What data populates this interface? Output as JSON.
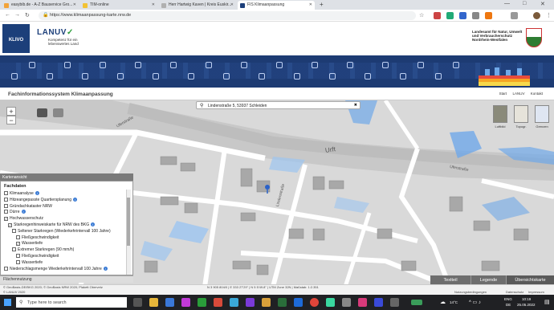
{
  "browser": {
    "tabs": [
      {
        "label": "easybib.de - A-Z Bauservice Gro...",
        "color": "#f2a33a"
      },
      {
        "label": "TIM-online",
        "color": "#f2c233"
      },
      {
        "label": "Herr Hartwig Kaven | Kreis Euskir...",
        "color": "#b0b0b0"
      },
      {
        "label": "FIS Klimaanpassung",
        "color": "#1c3f7a",
        "active": true
      }
    ],
    "new_tab": "+",
    "url": "https://www.klimaanpassung-karte.nrw.de"
  },
  "header": {
    "klivo": "KLIVO",
    "lanuv": "LANUV",
    "lanuv_tagline": "Kompetenz für ein lebenswertes Land",
    "agency": "Landesamt für Natur, Umwelt und Verbraucherschutz Nordrhein-Westfalen"
  },
  "titlebar": {
    "title": "Fachinformationssystem Klimaanpassung",
    "links": [
      "Start",
      "LANUV",
      "Kontakt"
    ]
  },
  "map": {
    "search_value": "Lindenstraße 5, 53937 Schleiden",
    "zoom_in": "+",
    "zoom_out": "−",
    "river_label": "Urft",
    "street_labels": [
      "Uferstraße",
      "Lindenstraße",
      "Uferstraße"
    ],
    "basemaps": [
      "Luftbild",
      "Topogr.",
      "Grenzen"
    ]
  },
  "panel": {
    "header": "Kartenansicht",
    "title": "Fachdaten",
    "layers": [
      {
        "label": "Klimaanalyse",
        "checked": false,
        "info": true,
        "indent": 0
      },
      {
        "label": "Hitzeangepasste Quartiersplanung",
        "checked": false,
        "info": true,
        "indent": 0
      },
      {
        "label": "Gründachkataster NRW",
        "checked": false,
        "info": false,
        "indent": 0
      },
      {
        "label": "Dürre",
        "checked": false,
        "info": true,
        "indent": 0
      },
      {
        "label": "Hochwasserschutz",
        "checked": true,
        "info": false,
        "indent": 0
      },
      {
        "label": "Starkregenhinweiskarte für NRW des BKG",
        "checked": true,
        "info": true,
        "indent": 1
      },
      {
        "label": "Seltener Starkregen (Wiederkehrintervall 100 Jahre)",
        "checked": false,
        "info": false,
        "indent": 2
      },
      {
        "label": "Fließgeschwindigkeit",
        "checked": false,
        "info": false,
        "indent": 3
      },
      {
        "label": "Wassertiefe",
        "checked": true,
        "info": false,
        "indent": 3
      },
      {
        "label": "Extremer Starkregen (90 mm/h)",
        "checked": false,
        "info": false,
        "indent": 2
      },
      {
        "label": "Fließgeschwindigkeit",
        "checked": false,
        "info": false,
        "indent": 3
      },
      {
        "label": "Wassertiefe",
        "checked": false,
        "info": false,
        "indent": 3
      },
      {
        "label": "Niederschlagsmenge Wiederkehrintervall 100 Jahre",
        "checked": false,
        "info": true,
        "indent": 0
      }
    ],
    "footer": "Flächennutzung"
  },
  "bottom_tabs": [
    "Textteil",
    "Legende",
    "Übersichtskarte"
  ],
  "status": {
    "left": "© GeoBasis-DE/BKG 2020; © GeoBasis NRW 2020; Plakett Obervetz",
    "left2": "© LANUV 2020",
    "coords": "N 3 905 804/0 | E 333 27'29\" | N 5 5'49.8\" | UTM Zone 32N | Maßstab: 1:2.351",
    "right": [
      "Nutzungsbedingungen",
      "Datenschutz",
      "Impressum"
    ]
  },
  "taskbar": {
    "search_placeholder": "Type here to search",
    "weather": "14°C",
    "lang": "ENG",
    "lang2": "DE",
    "time": "10:19",
    "date": "25.05.2022"
  },
  "colors": {
    "lanuv_blue": "#1c3f7a",
    "water": "#6fa8e8",
    "banner": "#1d3b73",
    "tab_dark": "#6e6e6e"
  }
}
